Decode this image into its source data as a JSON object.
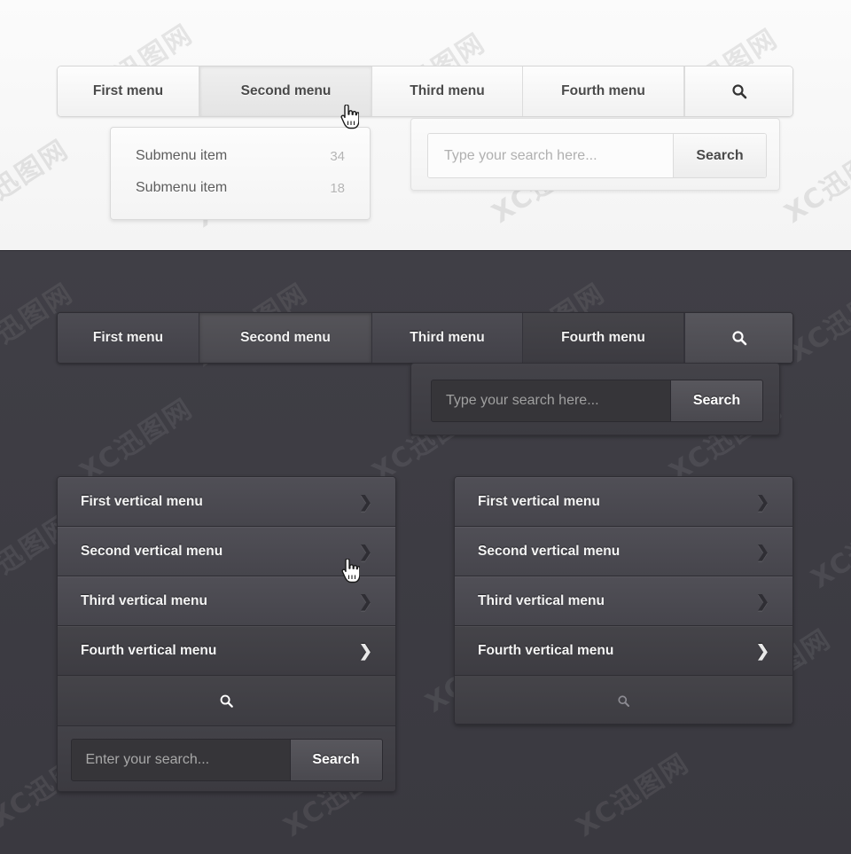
{
  "watermark": {
    "text": "XC迅图网"
  },
  "colors": {
    "light_bg": "#f7f7f7",
    "dark_bg": "#3d3c43",
    "light_text": "#4a4a4a",
    "dark_text": "#f4f4f4",
    "placeholder": "#b0b0b0",
    "count_text": "#b4b4b4"
  },
  "light_section": {
    "navbar": {
      "items": [
        {
          "label": "First menu",
          "state": "normal"
        },
        {
          "label": "Second menu",
          "state": "active"
        },
        {
          "label": "Third menu",
          "state": "normal"
        },
        {
          "label": "Fourth menu",
          "state": "normal"
        }
      ],
      "search_icon": "search-icon"
    },
    "submenu": {
      "items": [
        {
          "label": "Submenu item",
          "count": "34"
        },
        {
          "label": "Submenu item",
          "count": "18"
        }
      ]
    },
    "search_panel": {
      "placeholder": "Type your search here...",
      "value": "",
      "button_label": "Search"
    }
  },
  "dark_section": {
    "navbar": {
      "items": [
        {
          "label": "First menu",
          "state": "normal"
        },
        {
          "label": "Second menu",
          "state": "active"
        },
        {
          "label": "Third menu",
          "state": "normal"
        },
        {
          "label": "Fourth menu",
          "state": "dim"
        }
      ],
      "search_icon": "search-icon"
    },
    "search_panel": {
      "placeholder": "Type your search here...",
      "value": "",
      "button_label": "Search"
    },
    "vertical_menu_left": {
      "items": [
        {
          "label": "First vertical menu",
          "state": "normal",
          "chevron": "chevron-right-icon"
        },
        {
          "label": "Second vertical menu",
          "state": "normal",
          "chevron": "chevron-right-icon"
        },
        {
          "label": "Third vertical menu",
          "state": "normal",
          "chevron": "chevron-right-icon"
        },
        {
          "label": "Fourth vertical menu",
          "state": "dim",
          "chevron": "chevron-right-icon"
        }
      ],
      "search_icon": "search-icon",
      "search_box": {
        "placeholder": "Enter your search...",
        "value": "",
        "button_label": "Search"
      }
    },
    "vertical_menu_right": {
      "items": [
        {
          "label": "First vertical menu",
          "state": "normal",
          "chevron": "chevron-right-icon"
        },
        {
          "label": "Second vertical menu",
          "state": "normal",
          "chevron": "chevron-right-icon"
        },
        {
          "label": "Third vertical menu",
          "state": "normal",
          "chevron": "chevron-right-icon"
        },
        {
          "label": "Fourth vertical menu",
          "state": "dim",
          "chevron": "chevron-right-icon"
        }
      ],
      "search_icon": "search-icon"
    }
  }
}
